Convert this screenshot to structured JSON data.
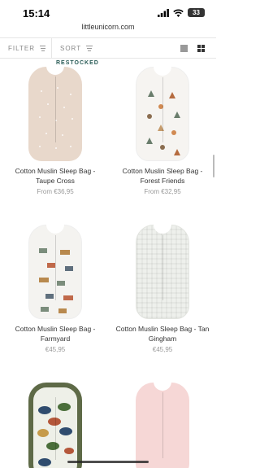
{
  "status": {
    "time": "15:14",
    "battery": "33"
  },
  "url": "littleunicorn.com",
  "toolbar": {
    "filter_label": "FILTER",
    "sort_label": "SORT"
  },
  "badge": "RESTOCKED",
  "products": [
    {
      "title": "Cotton Muslin Sleep Bag - Taupe Cross",
      "price": "From €36,95",
      "color": "#e8d8cb"
    },
    {
      "title": "Cotton Muslin Sleep Bag - Forest Friends",
      "price": "From €32,95",
      "color": "#f6f4f1"
    },
    {
      "title": "Cotton Muslin Sleep Bag - Farmyard",
      "price": "€45,95",
      "color": "#f4f3f0"
    },
    {
      "title": "Cotton Muslin Sleep Bag - Tan Gingham",
      "price": "€45,95",
      "color": "#eef0ec"
    },
    {
      "title": "",
      "price": "",
      "color": "#eef0e8"
    },
    {
      "title": "",
      "price": "",
      "color": "#f6d7d6"
    }
  ]
}
